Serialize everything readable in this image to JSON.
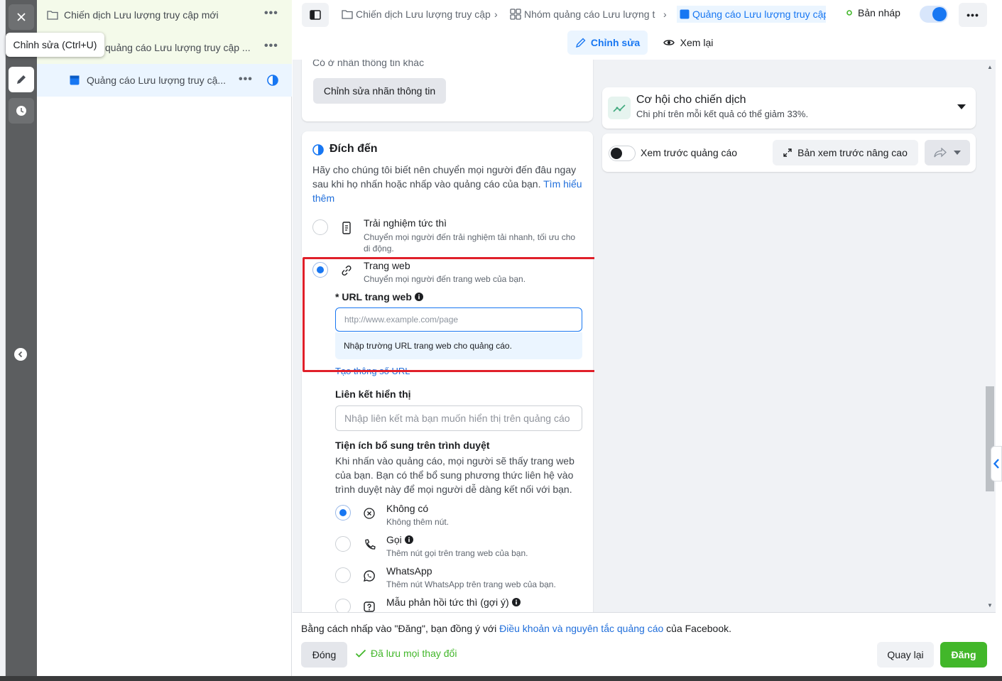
{
  "tooltip": "Chỉnh sửa (Ctrl+U)",
  "tree": {
    "campaign": "Chiến dịch Lưu lượng truy cập mới",
    "adset": "quảng cáo Lưu lượng truy cập ...",
    "ad": "Quảng cáo Lưu lượng truy cậ..."
  },
  "breadcrumb": {
    "campaign": "Chiến dịch Lưu lượng truy cập",
    "adset": "Nhóm quảng cáo Lưu lượng t",
    "ad": "Quảng cáo Lưu lượng truy cập"
  },
  "status": {
    "draft": "Bản nháp"
  },
  "tabs": {
    "edit": "Chỉnh sửa",
    "review": "Xem lại"
  },
  "top_card": {
    "cut_text": "Có ở nhãn thông tin khác",
    "edit_labels_button": "Chỉnh sửa nhãn thông tin"
  },
  "destination": {
    "title": "Đích đến",
    "desc": "Hãy cho chúng tôi biết nên chuyển mọi người đến đâu ngay sau khi họ nhấn hoặc nhấp vào quảng cáo của bạn.",
    "learn_more": "Tìm hiểu thêm",
    "instant": {
      "title": "Trải nghiệm tức thì",
      "desc": "Chuyển mọi người đến trải nghiệm tải nhanh, tối ưu cho di động."
    },
    "website": {
      "title": "Trang web",
      "desc": "Chuyển mọi người đến trang web của bạn."
    },
    "url_label": "* URL trang web",
    "url_placeholder": "http://www.example.com/page",
    "url_hint": "Nhập trường URL trang web cho quảng cáo.",
    "url_params_link": "Tạo thông số URL",
    "display_link_label": "Liên kết hiển thị",
    "display_link_placeholder": "Nhập liên kết mà bạn muốn hiển thị trên quảng cáo",
    "browser_addon_title": "Tiện ích bổ sung trên trình duyệt",
    "browser_addon_desc": "Khi nhấn vào quảng cáo, mọi người sẽ thấy trang web của bạn. Bạn có thể bổ sung phương thức liên hệ vào trình duyệt này để mọi người dễ dàng kết nối với bạn.",
    "addons": [
      {
        "title": "Không có",
        "desc": "Không thêm nút.",
        "selected": true,
        "icon": "x-circle-icon"
      },
      {
        "title": "Gọi",
        "desc": "Thêm nút gọi trên trang web của bạn.",
        "selected": false,
        "icon": "phone-icon"
      },
      {
        "title": "WhatsApp",
        "desc": "Thêm nút WhatsApp trên trang web của bạn.",
        "selected": false,
        "icon": "whatsapp-icon"
      },
      {
        "title": "Mẫu phản hồi tức thì (gợi ý)",
        "desc": "",
        "selected": false,
        "icon": "question-icon"
      }
    ]
  },
  "preview": {
    "opportunity_title": "Cơ hội cho chiến dịch",
    "opportunity_desc": "Chi phí trên mỗi kết quả có thể giảm 33%.",
    "preview_toggle_label": "Xem trước quảng cáo",
    "advanced_preview": "Bản xem trước nâng cao"
  },
  "footer": {
    "terms_prefix": "Bằng cách nhấp vào \"Đăng\", bạn đồng ý với ",
    "terms_link": "Điều khoản và nguyên tắc quảng cáo",
    "terms_suffix": " của Facebook.",
    "close": "Đóng",
    "saved": "Đã lưu mọi thay đổi",
    "back": "Quay lại",
    "publish": "Đăng"
  },
  "colors": {
    "accent": "#1877f2",
    "publish": "#42b72a",
    "highlight": "#e0202a",
    "saved": "#42b72a"
  }
}
